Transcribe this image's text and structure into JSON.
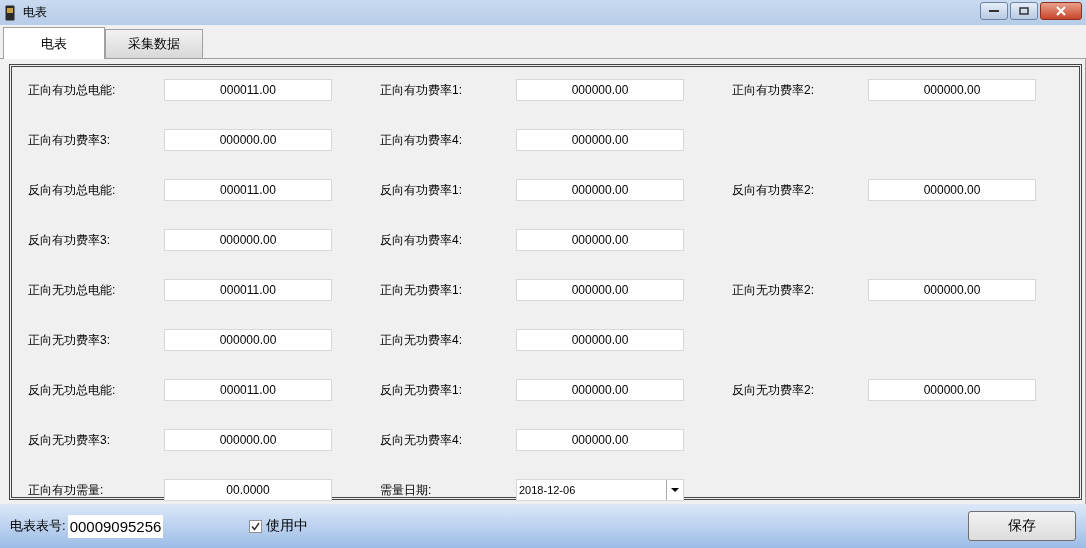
{
  "window": {
    "title": "电表"
  },
  "tabs": [
    {
      "label": "电表",
      "selected": true
    },
    {
      "label": "采集数据",
      "selected": false
    }
  ],
  "rows": [
    [
      {
        "label": "正向有功总电能:",
        "value": "000011.00",
        "kind": "text"
      },
      {
        "label": "正向有功费率1:",
        "value": "000000.00",
        "kind": "text"
      },
      {
        "label": "正向有功费率2:",
        "value": "000000.00",
        "kind": "text"
      }
    ],
    [
      {
        "label": "正向有功费率3:",
        "value": "000000.00",
        "kind": "text"
      },
      {
        "label": "正向有功费率4:",
        "value": "000000.00",
        "kind": "text"
      }
    ],
    [
      {
        "label": "反向有功总电能:",
        "value": "000011.00",
        "kind": "text"
      },
      {
        "label": "反向有功费率1:",
        "value": "000000.00",
        "kind": "text"
      },
      {
        "label": "反向有功费率2:",
        "value": "000000.00",
        "kind": "text"
      }
    ],
    [
      {
        "label": "反向有功费率3:",
        "value": "000000.00",
        "kind": "text"
      },
      {
        "label": "反向有功费率4:",
        "value": "000000.00",
        "kind": "text"
      }
    ],
    [
      {
        "label": "正向无功总电能:",
        "value": "000011.00",
        "kind": "text"
      },
      {
        "label": "正向无功费率1:",
        "value": "000000.00",
        "kind": "text"
      },
      {
        "label": "正向无功费率2:",
        "value": "000000.00",
        "kind": "text"
      }
    ],
    [
      {
        "label": "正向无功费率3:",
        "value": "000000.00",
        "kind": "text"
      },
      {
        "label": "正向无功费率4:",
        "value": "000000.00",
        "kind": "text"
      }
    ],
    [
      {
        "label": "反向无功总电能:",
        "value": "000011.00",
        "kind": "text"
      },
      {
        "label": "反向无功费率1:",
        "value": "000000.00",
        "kind": "text"
      },
      {
        "label": "反向无功费率2:",
        "value": "000000.00",
        "kind": "text"
      }
    ],
    [
      {
        "label": "反向无功费率3:",
        "value": "000000.00",
        "kind": "text"
      },
      {
        "label": "反向无功费率4:",
        "value": "000000.00",
        "kind": "text"
      }
    ],
    [
      {
        "label": "正向有功需量:",
        "value": "00.0000",
        "kind": "text"
      },
      {
        "label": "需量日期:",
        "value": "2018-12-06",
        "kind": "date"
      }
    ]
  ],
  "footer": {
    "meter_label": "电表表号:",
    "meter_number": "00009095256",
    "in_use": {
      "label": "使用中",
      "checked": true
    },
    "save_button": "保存"
  }
}
